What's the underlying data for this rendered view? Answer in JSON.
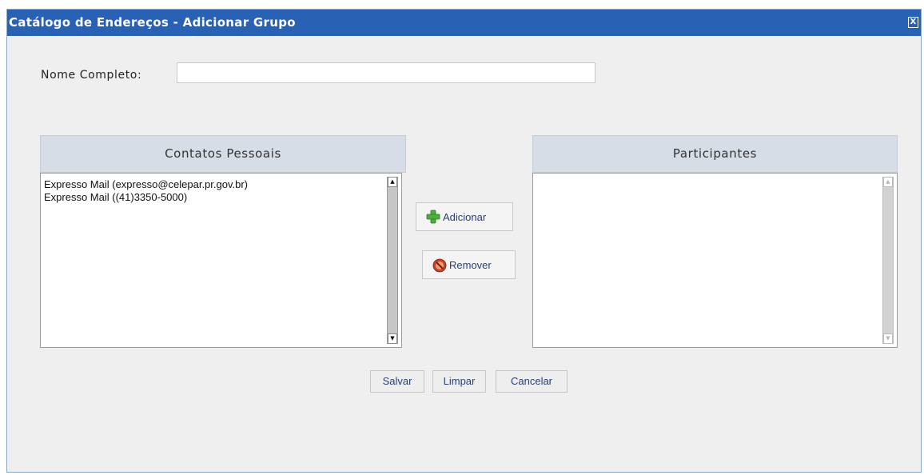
{
  "window": {
    "title": "Catálogo de Endereços - Adicionar Grupo",
    "close_label": "X"
  },
  "form": {
    "name_label": "Nome Completo:",
    "name_value": ""
  },
  "contacts_panel": {
    "header": "Contatos Pessoais",
    "items": [
      "Expresso Mail (expresso@celepar.pr.gov.br)",
      "Expresso Mail ((41)3350-5000)"
    ]
  },
  "participants_panel": {
    "header": "Participantes",
    "items": []
  },
  "actions": {
    "add_label": "Adicionar",
    "remove_label": "Remover"
  },
  "footer": {
    "save_label": "Salvar",
    "clear_label": "Limpar",
    "cancel_label": "Cancelar"
  },
  "icons": {
    "add": "green-plus-icon",
    "remove": "red-remove-icon",
    "close": "close-icon"
  },
  "colors": {
    "titlebar": "#2961b5",
    "panel_header": "#d6dde6",
    "button_text": "#2a3f78",
    "dialog_bg": "#efefef"
  }
}
